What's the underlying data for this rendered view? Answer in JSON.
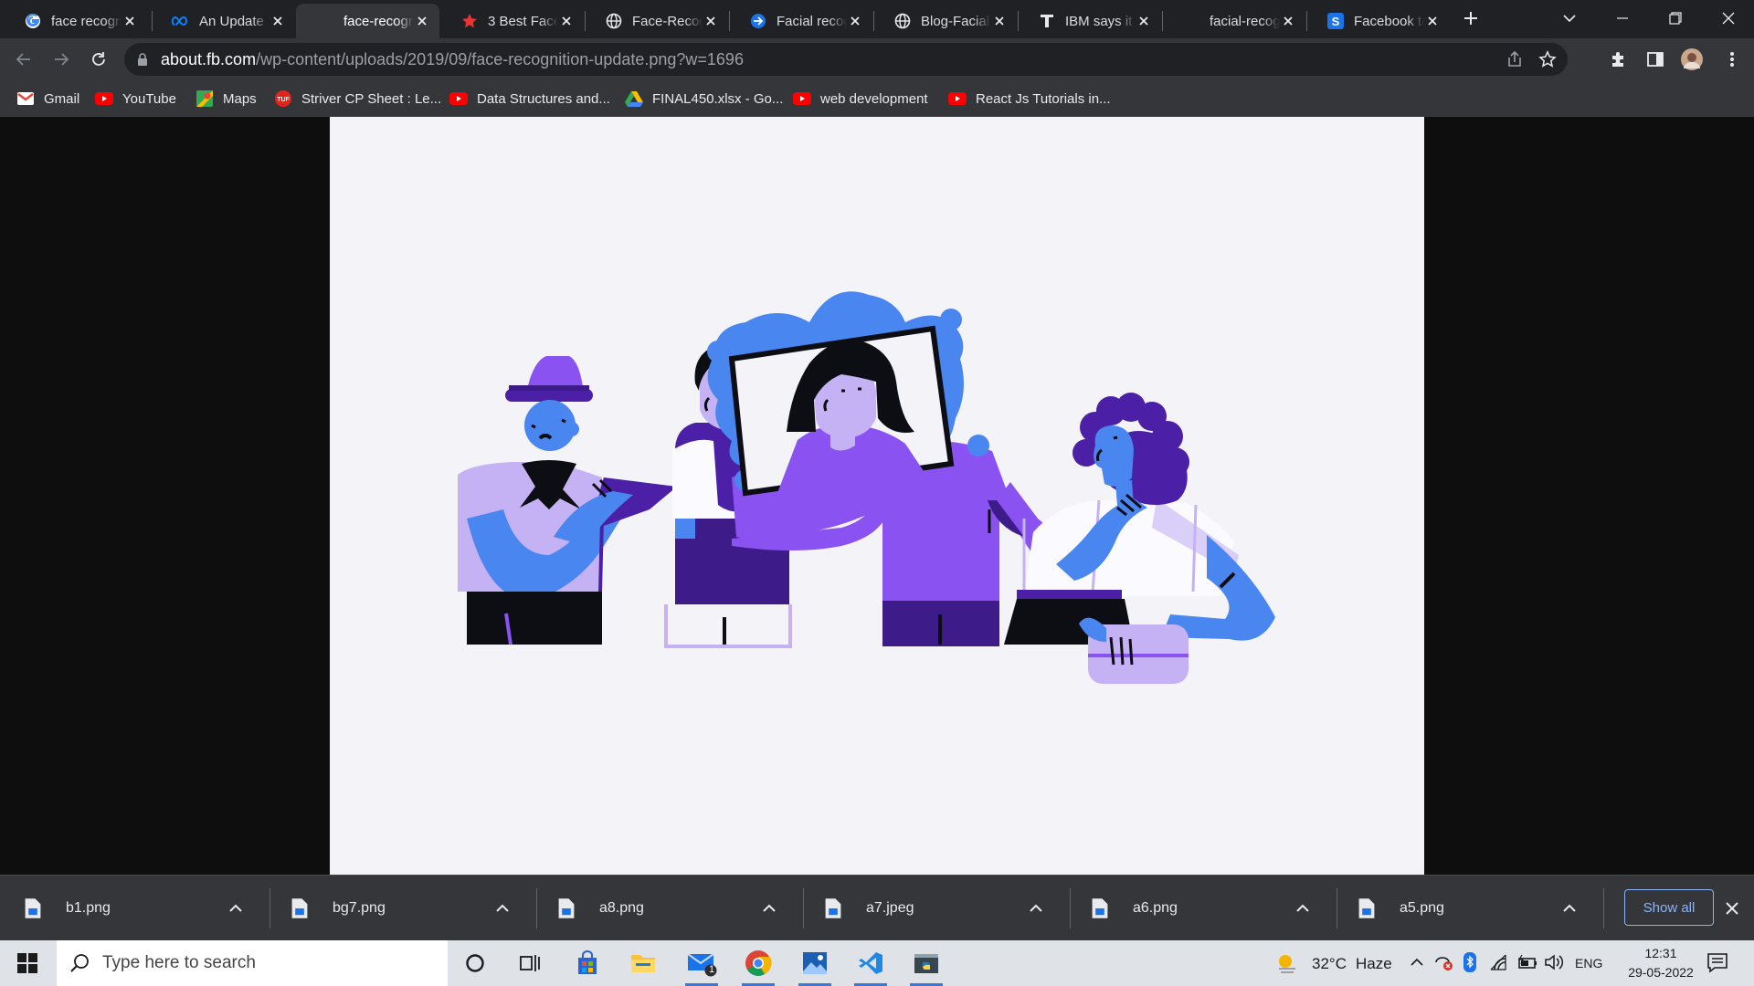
{
  "browser": {
    "tabs": [
      {
        "title": "face recogn",
        "icon": "google-g-icon",
        "active": false
      },
      {
        "title": "An Update",
        "icon": "meta-infinity-icon",
        "active": false
      },
      {
        "title": "face-recogn",
        "icon": "none",
        "active": true
      },
      {
        "title": "3 Best Face",
        "icon": "red-star-icon",
        "active": false
      },
      {
        "title": "Face-Recog",
        "icon": "globe-icon",
        "active": false
      },
      {
        "title": "Facial recog",
        "icon": "blue-arrow-icon",
        "active": false
      },
      {
        "title": "Blog-Facial",
        "icon": "globe-icon",
        "active": false
      },
      {
        "title": "IBM says it",
        "icon": "t-letter-icon",
        "active": false
      },
      {
        "title": "facial-recog",
        "icon": "none",
        "active": false
      },
      {
        "title": "Facebook to",
        "icon": "s-letter-icon",
        "active": false
      }
    ],
    "address": {
      "domain": "about.fb.com",
      "path": "/wp-content/uploads/2019/09/face-recognition-update.png?w=1696"
    },
    "bookmarks": [
      {
        "label": "Gmail",
        "icon": "gmail-icon"
      },
      {
        "label": "YouTube",
        "icon": "youtube-icon"
      },
      {
        "label": "Maps",
        "icon": "maps-icon"
      },
      {
        "label": "Striver CP Sheet : Le...",
        "icon": "tuf-icon"
      },
      {
        "label": "Data Structures and...",
        "icon": "youtube-icon"
      },
      {
        "label": "FINAL450.xlsx - Go...",
        "icon": "google-drive-icon"
      },
      {
        "label": "web development",
        "icon": "youtube-icon"
      },
      {
        "label": "React Js Tutorials in...",
        "icon": "youtube-icon"
      }
    ]
  },
  "downloads": {
    "items": [
      "b1.png",
      "bg7.png",
      "a8.png",
      "a7.jpeg",
      "a6.png",
      "a5.png"
    ],
    "show_all_label": "Show all"
  },
  "taskbar": {
    "search_placeholder": "Type here to search",
    "mail_badge": "1",
    "weather_temp": "32°C",
    "weather_desc": "Haze",
    "language": "ENG",
    "time": "12:31",
    "date": "29-05-2022"
  },
  "colors": {
    "tab_strip": "#202124",
    "toolbar": "#35363a",
    "accent_blue": "#8ab4f8",
    "illus_blue": "#4a86f0",
    "illus_violet": "#8a52f0",
    "illus_lavender": "#c5b2f5",
    "illus_indigo": "#3d1c8a"
  }
}
